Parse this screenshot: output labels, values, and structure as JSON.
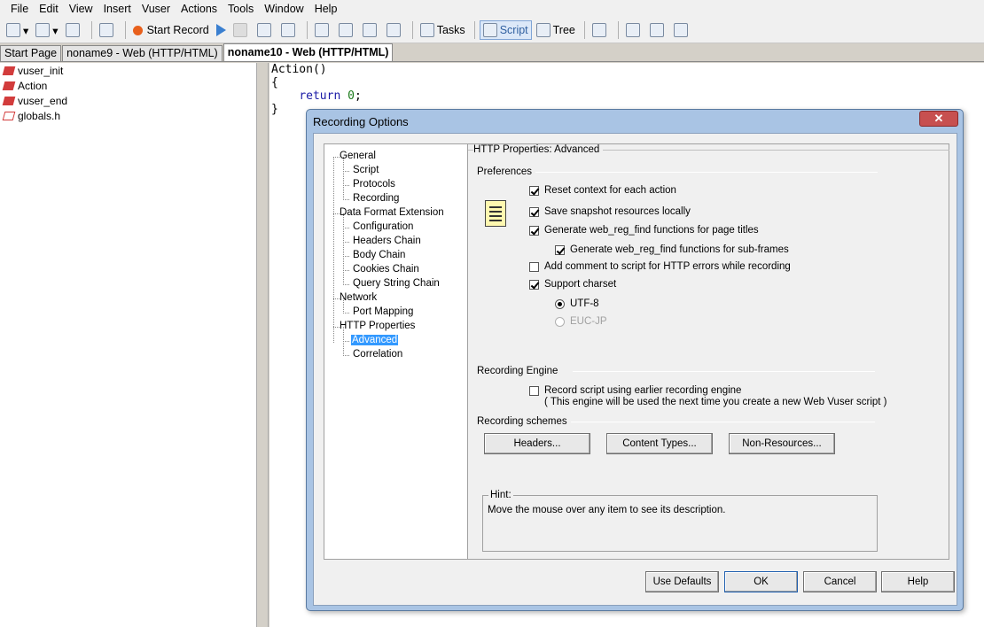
{
  "menu": [
    "File",
    "Edit",
    "View",
    "Insert",
    "Vuser",
    "Actions",
    "Tools",
    "Window",
    "Help"
  ],
  "toolbar": {
    "start_record": "Start Record",
    "tasks": "Tasks",
    "script": "Script",
    "tree": "Tree"
  },
  "tabs": [
    "Start Page",
    "noname9 - Web (HTTP/HTML)",
    "noname10 - Web (HTTP/HTML)"
  ],
  "script_tree": [
    "vuser_init",
    "Action",
    "vuser_end",
    "globals.h"
  ],
  "code": {
    "line1": "Action()",
    "line2": "{",
    "line3_kw": "return",
    "line3_num": "0",
    "line4": "}"
  },
  "dialog": {
    "title": "Recording Options",
    "close": "✕",
    "nav": {
      "general": "General",
      "script": "Script",
      "protocols": "Protocols",
      "recording": "Recording",
      "dfe": "Data Format Extension",
      "configuration": "Configuration",
      "headers_chain": "Headers Chain",
      "body_chain": "Body Chain",
      "cookies_chain": "Cookies Chain",
      "query_chain": "Query String Chain",
      "network": "Network",
      "port_mapping": "Port Mapping",
      "http_props": "HTTP Properties",
      "advanced": "Advanced",
      "correlation": "Correlation"
    },
    "panel_title": "HTTP Properties: Advanced",
    "preferences": "Preferences",
    "opt1": "Reset context for each action",
    "opt2": "Save snapshot resources locally",
    "opt3": "Generate web_reg_find functions for page titles",
    "opt4": "Generate web_reg_find functions for sub-frames",
    "opt5": "Add comment to script for HTTP errors while recording",
    "opt6": "Support charset",
    "utf8": "UTF-8",
    "eucjp": "EUC-JP",
    "recording_engine": "Recording Engine",
    "engine_opt": "Record script using earlier recording engine",
    "engine_note": "( This engine will be used the next time you create a new Web Vuser script )",
    "recording_schemes": "Recording schemes",
    "headers_btn": "Headers...",
    "content_types_btn": "Content Types...",
    "non_resources_btn": "Non-Resources...",
    "hint_label": "Hint:",
    "hint_text": "Move the mouse over any item to see its description.",
    "use_defaults": "Use Defaults",
    "ok": "OK",
    "cancel": "Cancel",
    "help": "Help"
  }
}
